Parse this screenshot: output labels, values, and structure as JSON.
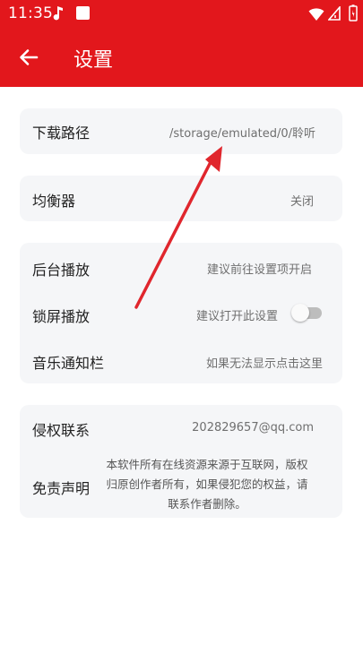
{
  "status_bar": {
    "time": "11:35",
    "icons": [
      "music-note-icon",
      "app-square-icon",
      "wifi-icon",
      "signal-icon",
      "battery-icon"
    ]
  },
  "header": {
    "title": "设置",
    "back_icon": "arrow-left-icon",
    "background": "#e2171c"
  },
  "sections": {
    "download": {
      "label": "下载路径",
      "value": "/storage/emulated/0/聆听"
    },
    "equalizer": {
      "label": "均衡器",
      "value": "关闭"
    },
    "playback": {
      "background_play": {
        "label": "后台播放",
        "value": "建议前往设置项开启"
      },
      "lockscreen_play": {
        "label": "锁屏播放",
        "value": "建议打开此设置",
        "toggle_on": false
      },
      "notification_bar": {
        "label": "音乐通知栏",
        "value": "如果无法显示点击这里"
      }
    },
    "legal": {
      "infringement": {
        "label": "侵权联系",
        "value": "202829657@qq.com"
      },
      "disclaimer": {
        "label": "免责声明",
        "value": "本软件所有在线资源来源于互联网，版权归原创作者所有，如果侵犯您的权益，请联系作者删除。"
      }
    }
  },
  "annotation_arrow_color": "#e0262d"
}
